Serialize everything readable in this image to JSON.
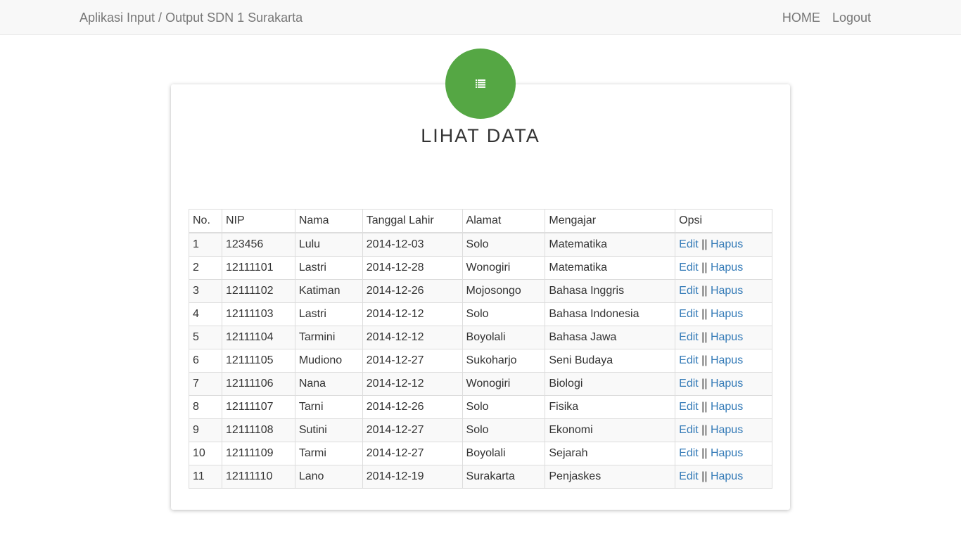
{
  "navbar": {
    "brand": "Aplikasi Input / Output SDN 1 Surakarta",
    "home": "HOME",
    "logout": "Logout"
  },
  "page": {
    "icon": "list-icon",
    "title": "LIHAT DATA",
    "accent_color": "#55a744",
    "link_color": "#337ab7"
  },
  "table": {
    "headers": [
      "No.",
      "NIP",
      "Nama",
      "Tanggal Lahir",
      "Alamat",
      "Mengajar",
      "Opsi"
    ],
    "edit_label": "Edit",
    "separator": "||",
    "delete_label": "Hapus",
    "rows": [
      [
        "1",
        "123456",
        "Lulu",
        "2014-12-03",
        "Solo",
        "Matematika"
      ],
      [
        "2",
        "12111101",
        "Lastri",
        "2014-12-28",
        "Wonogiri",
        "Matematika"
      ],
      [
        "3",
        "12111102",
        "Katiman",
        "2014-12-26",
        "Mojosongo",
        "Bahasa Inggris"
      ],
      [
        "4",
        "12111103",
        "Lastri",
        "2014-12-12",
        "Solo",
        "Bahasa Indonesia"
      ],
      [
        "5",
        "12111104",
        "Tarmini",
        "2014-12-12",
        "Boyolali",
        "Bahasa Jawa"
      ],
      [
        "6",
        "12111105",
        "Mudiono",
        "2014-12-27",
        "Sukoharjo",
        "Seni Budaya"
      ],
      [
        "7",
        "12111106",
        "Nana",
        "2014-12-12",
        "Wonogiri",
        "Biologi"
      ],
      [
        "8",
        "12111107",
        "Tarni",
        "2014-12-26",
        "Solo",
        "Fisika"
      ],
      [
        "9",
        "12111108",
        "Sutini",
        "2014-12-27",
        "Solo",
        "Ekonomi"
      ],
      [
        "10",
        "12111109",
        "Tarmi",
        "2014-12-27",
        "Boyolali",
        "Sejarah"
      ],
      [
        "11",
        "12111110",
        "Lano",
        "2014-12-19",
        "Surakarta",
        "Penjaskes"
      ]
    ]
  }
}
